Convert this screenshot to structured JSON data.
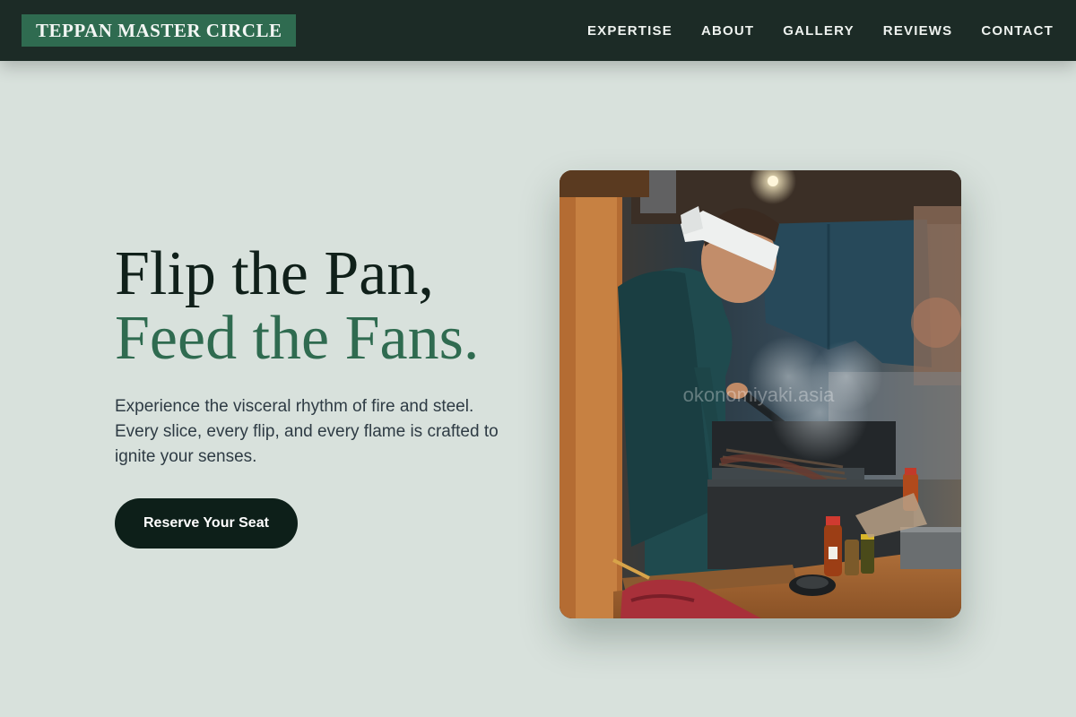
{
  "header": {
    "logo": "TEPPAN MASTER CIRCLE",
    "nav": [
      "EXPERTISE",
      "ABOUT",
      "GALLERY",
      "REVIEWS",
      "CONTACT"
    ]
  },
  "hero": {
    "headline_line1": "Flip the Pan,",
    "headline_line2": "Feed the Fans.",
    "description": "Experience the visceral rhythm of fire and steel. Every slice, every flip, and every flame is crafted to ignite your senses.",
    "cta_label": "Reserve Your Seat",
    "image_watermark": "okonomiyaki.asia"
  },
  "colors": {
    "page_background": "#d8e1dc",
    "header_background": "#1c2b26",
    "accent_green": "#2f6b50",
    "headline_dark": "#10201a",
    "cta_background": "#0d1f19"
  }
}
